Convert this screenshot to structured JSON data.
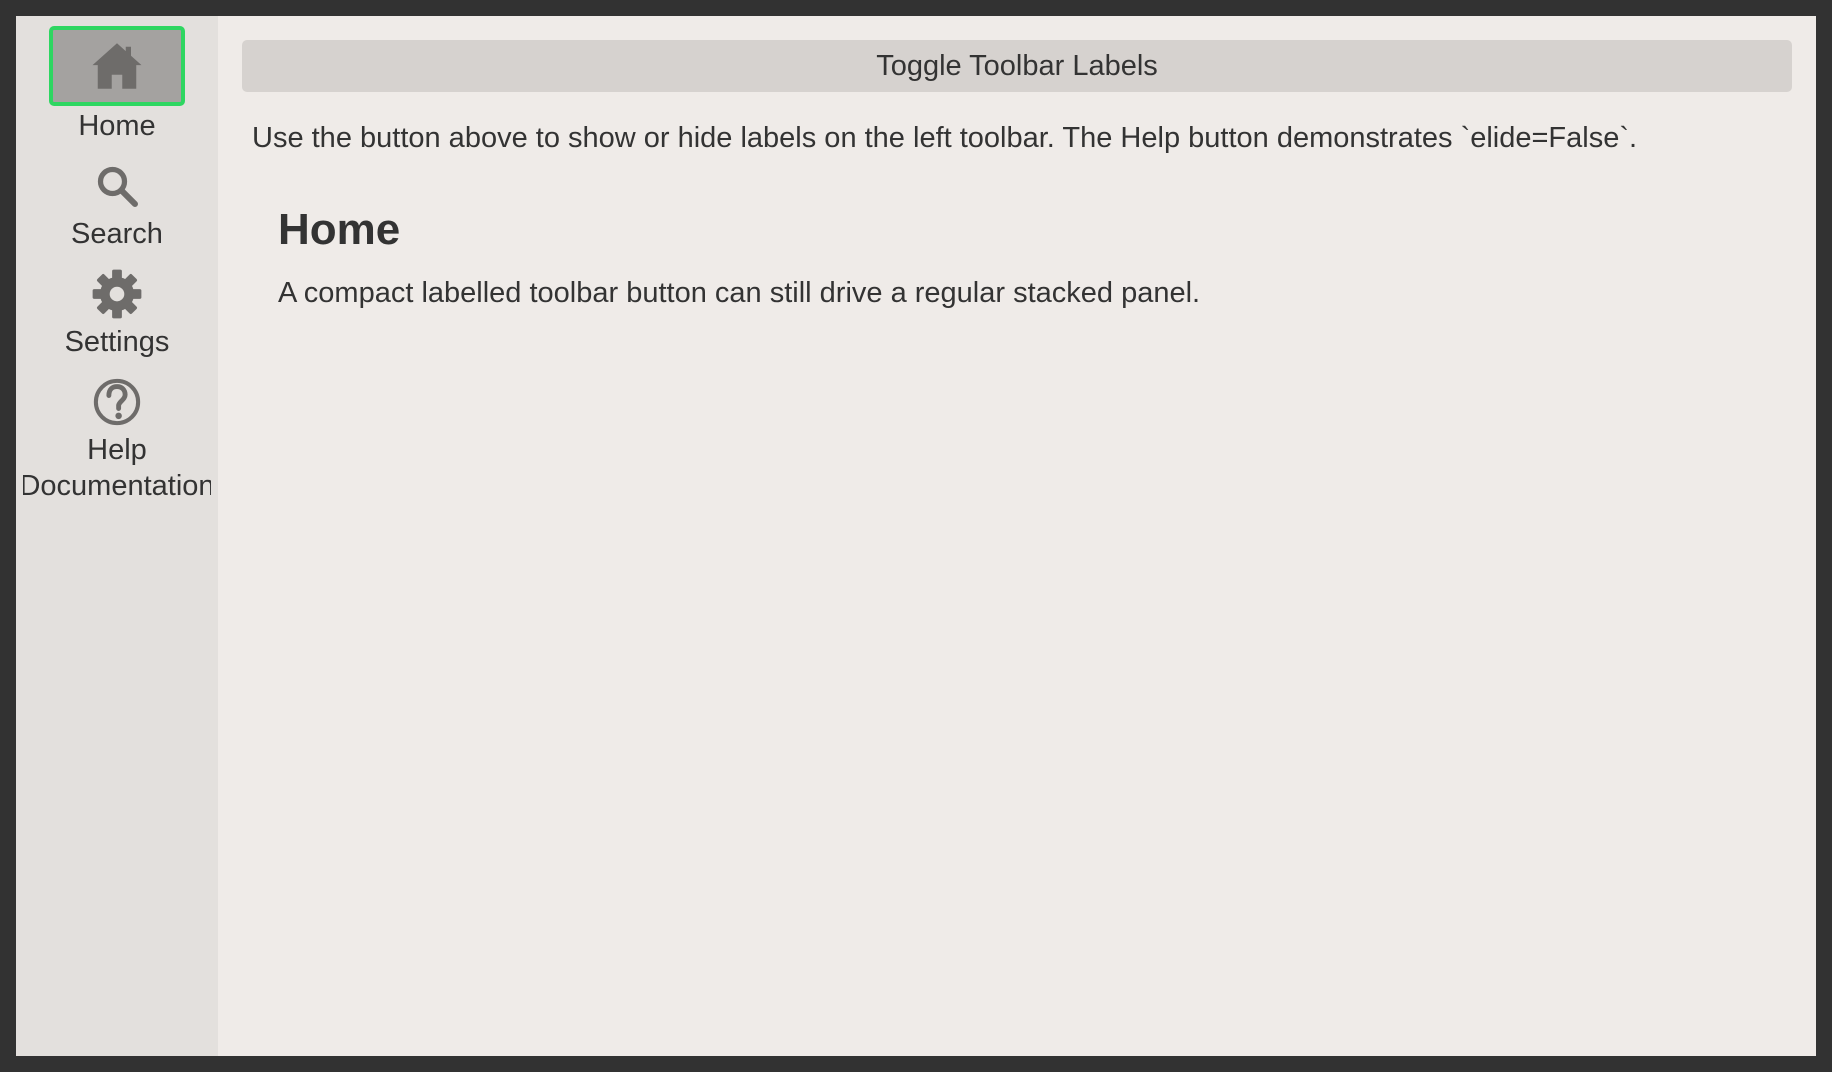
{
  "toolbar": {
    "items": [
      {
        "label": "Home",
        "icon": "home-icon",
        "active": true
      },
      {
        "label": "Search",
        "icon": "search-icon",
        "active": false
      },
      {
        "label": "Settings",
        "icon": "gear-icon",
        "active": false
      },
      {
        "label": "Help Documentation",
        "label_line1": "Help",
        "label_line2": "Documentation",
        "icon": "help-icon",
        "active": false
      }
    ]
  },
  "main": {
    "toggle_label": "Toggle Toolbar Labels",
    "instructions": "Use the button above to show or hide labels on the left toolbar. The Help button demonstrates `elide=False`.",
    "panel": {
      "title": "Home",
      "text": "A compact labelled toolbar button can still drive a regular stacked panel."
    }
  },
  "colors": {
    "active_border": "#2ed661",
    "sidebar_bg": "#e3e0dd",
    "content_bg": "#efebe8",
    "frame_bg": "#323232"
  }
}
